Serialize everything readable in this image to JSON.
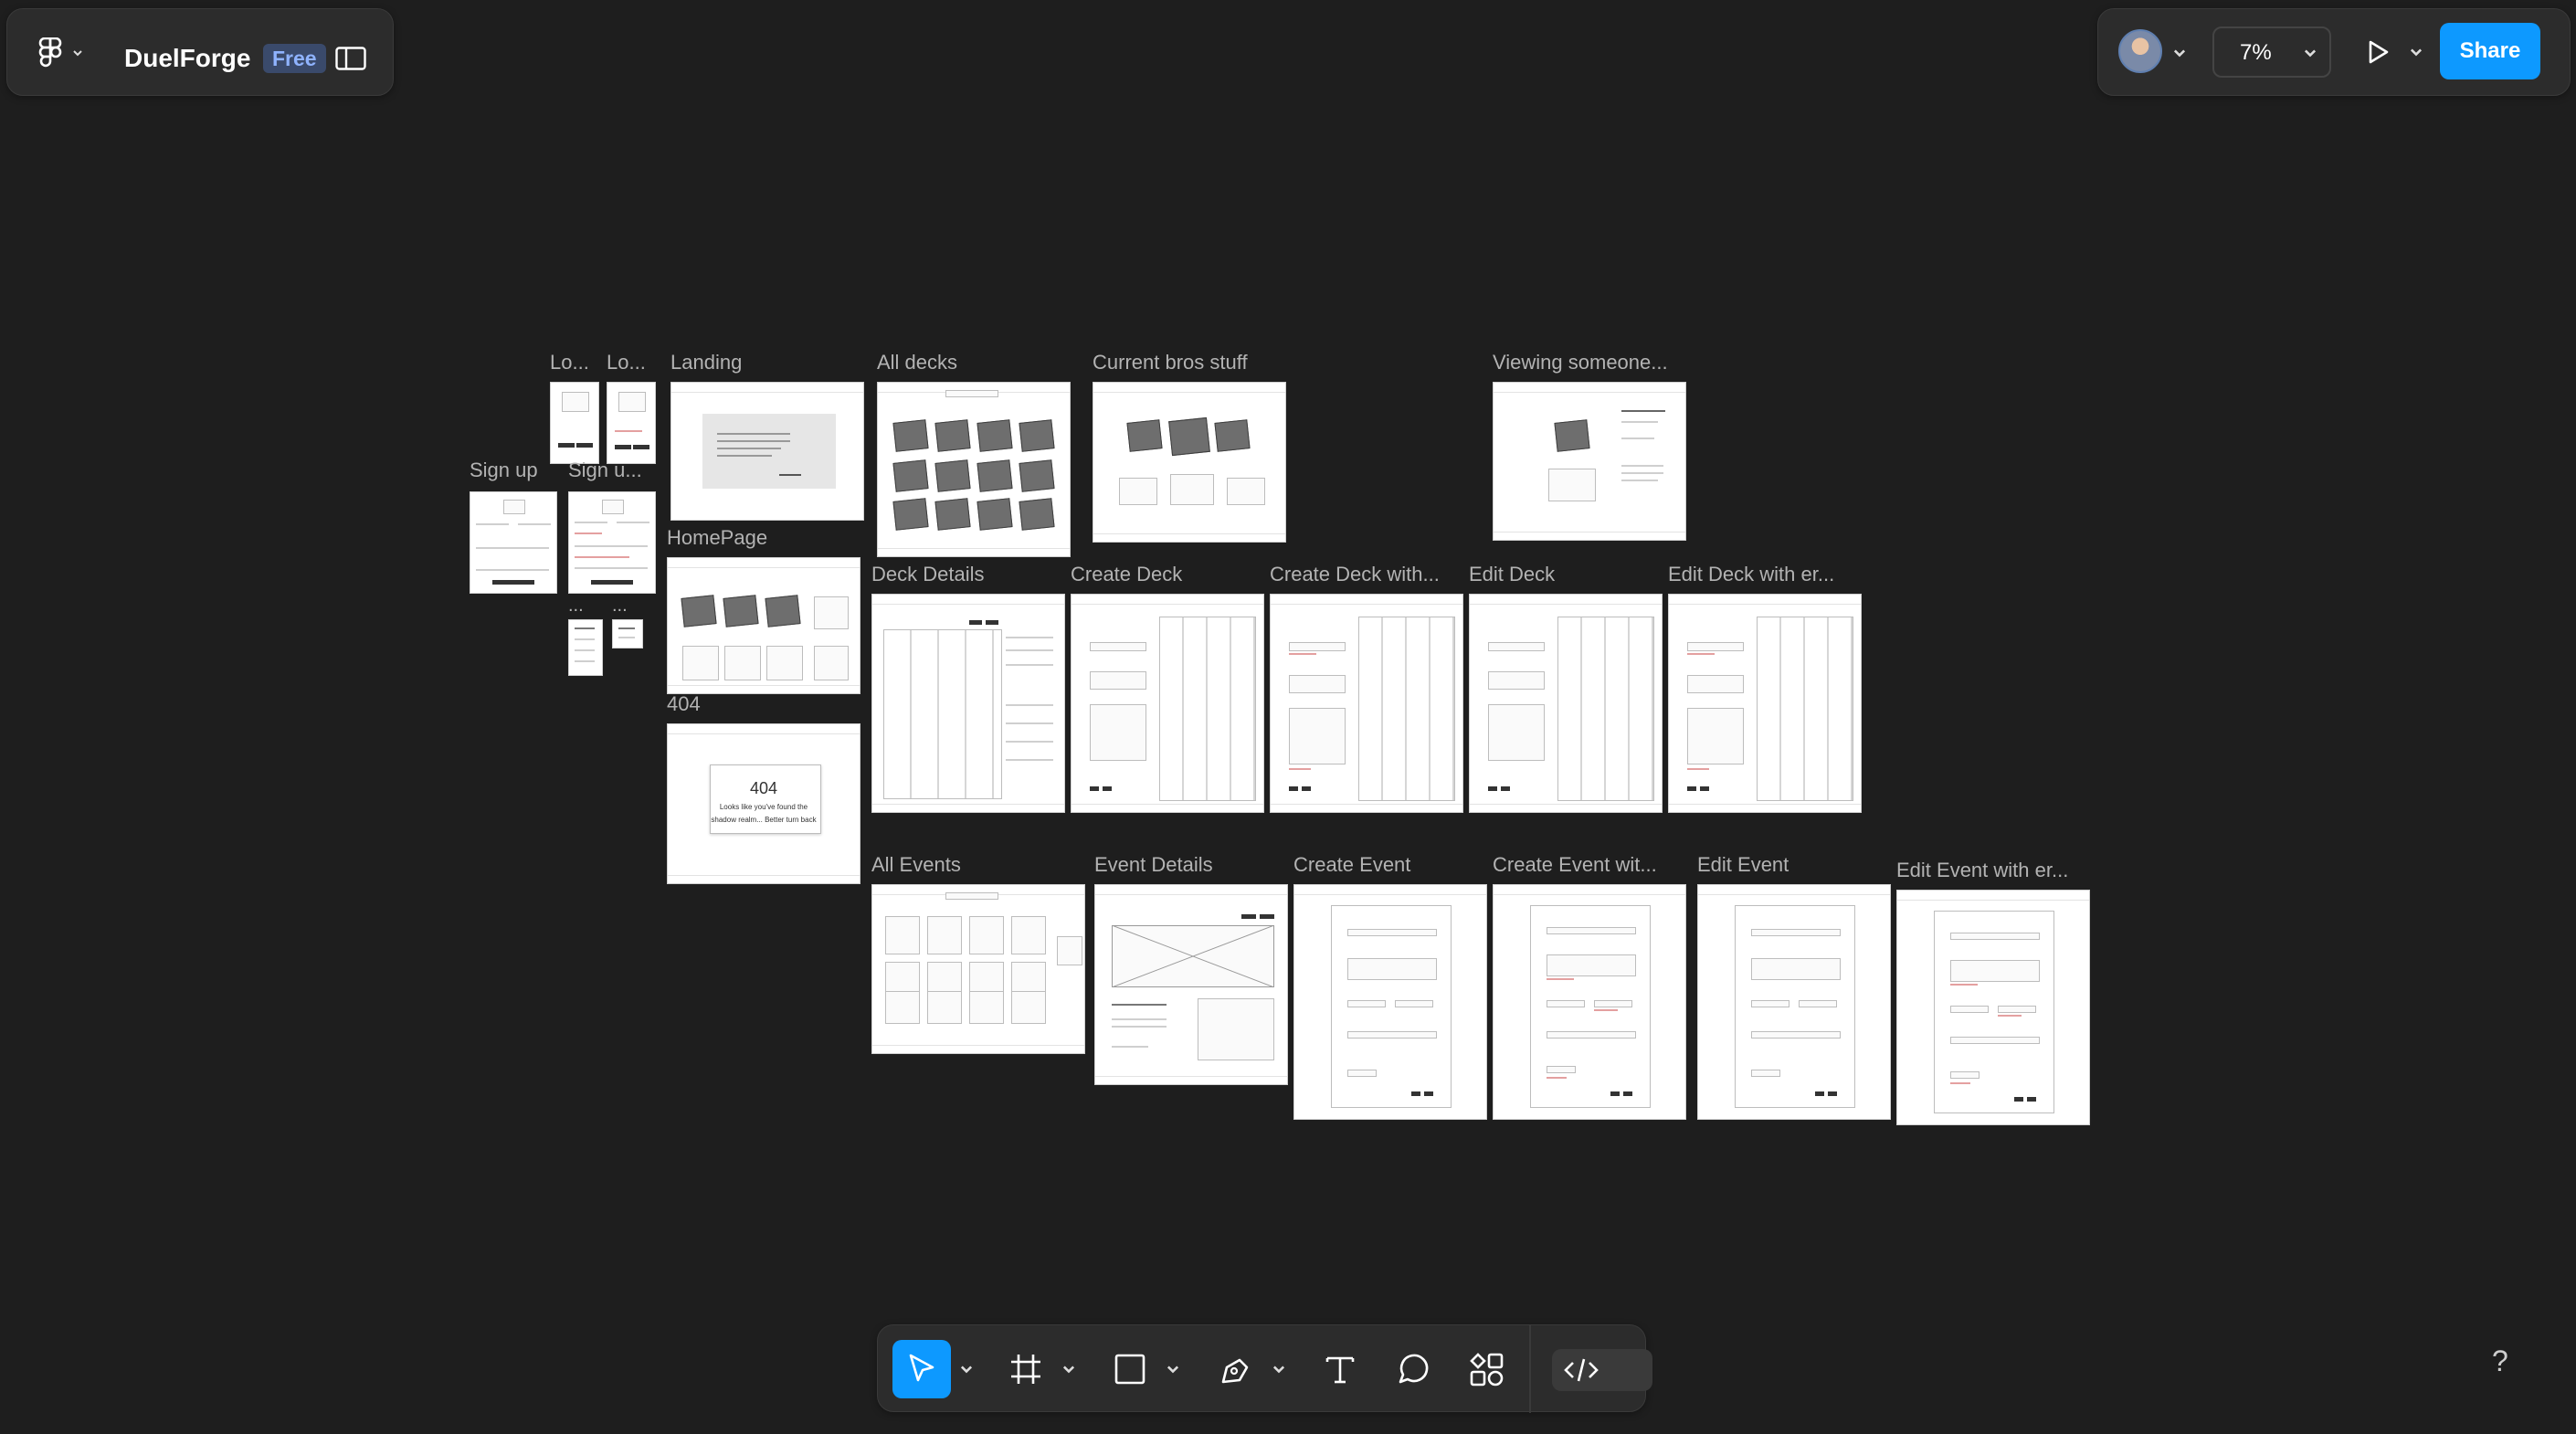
{
  "app": {
    "name": "DuelForge",
    "plan_badge": "Free"
  },
  "toolbar_right": {
    "zoom": "7%",
    "share_label": "Share"
  },
  "bottom_toolbar": {
    "tools": [
      "move-tool-icon",
      "frame-tool-icon",
      "shape-tool-icon",
      "pen-tool-icon",
      "text-tool-icon",
      "comment-tool-icon",
      "actions-icon",
      "dev-mode-icon"
    ],
    "active_tool": "move"
  },
  "help_label": "?",
  "colors": {
    "accent": "#0d99ff",
    "canvas": "#1e1e1e",
    "panel": "#2c2c2c"
  },
  "frames": {
    "lo1": "Lo...",
    "lo2": "Lo...",
    "landing": "Landing",
    "all_decks": "All decks",
    "current_bros": "Current bros stuff",
    "viewing_someone": "Viewing someone...",
    "sign_up": "Sign up",
    "sign_up_2": "Sign u...",
    "homepage": "HomePage",
    "dots1": "...",
    "dots2": "...",
    "deck_details": "Deck Details",
    "create_deck": "Create Deck",
    "create_deck_with": "Create Deck with...",
    "edit_deck": "Edit Deck",
    "edit_deck_with_er": "Edit Deck with er...",
    "nf404": "404",
    "all_events": "All Events",
    "event_details": "Event Details",
    "create_event": "Create Event",
    "create_event_wit": "Create Event wit...",
    "edit_event": "Edit Event",
    "edit_event_with_er": "Edit Event with er..."
  },
  "frame_404": {
    "code": "404",
    "line1": "Looks like you've found the",
    "line2": "shadow realm... Better turn back"
  }
}
